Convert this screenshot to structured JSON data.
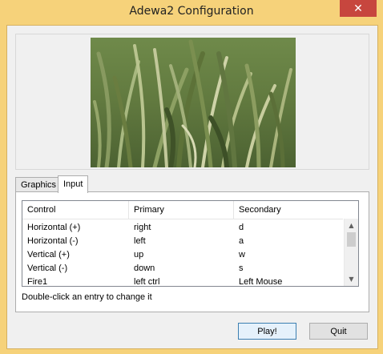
{
  "window": {
    "title": "Adewa2 Configuration",
    "close_glyph": "✕"
  },
  "banner": {
    "image_name": "grass-banner"
  },
  "tabs": [
    {
      "label": "Graphics",
      "selected": false
    },
    {
      "label": "Input",
      "selected": true
    }
  ],
  "input_list": {
    "columns": [
      "Control",
      "Primary",
      "Secondary"
    ],
    "rows": [
      [
        "Horizontal (+)",
        "right",
        "d"
      ],
      [
        "Horizontal (-)",
        "left",
        "a"
      ],
      [
        "Vertical (+)",
        "up",
        "w"
      ],
      [
        "Vertical (-)",
        "down",
        "s"
      ],
      [
        "Fire1",
        "left ctrl",
        "Left Mouse"
      ]
    ],
    "scroll_up_icon": "▲",
    "scroll_down_icon": "▼"
  },
  "hint": "Double-click an entry to change it",
  "buttons": {
    "play": "Play!",
    "quit": "Quit"
  },
  "colors": {
    "window_frame": "#f6d27a",
    "close_button": "#c7463e",
    "client_bg": "#f0f0f0"
  }
}
